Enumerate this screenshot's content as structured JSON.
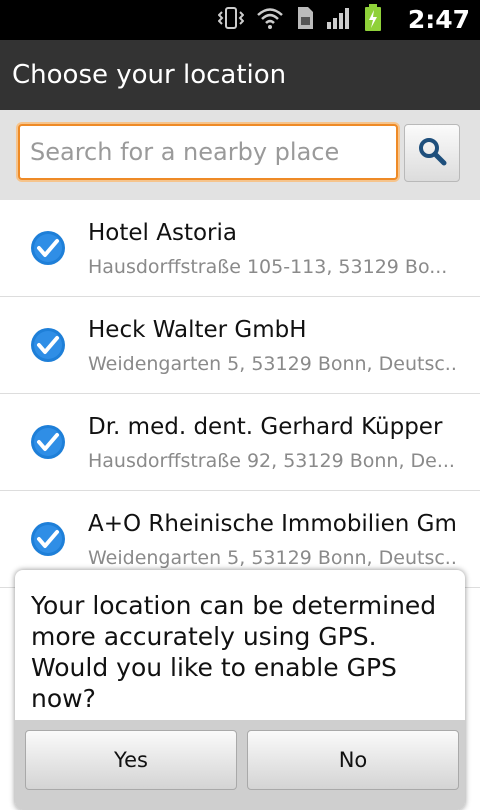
{
  "status_bar": {
    "time": "2:47",
    "icons": [
      "vibrate-icon",
      "wifi-icon",
      "sim-card-icon",
      "signal-icon",
      "battery-charging-icon"
    ]
  },
  "title_bar": {
    "title": "Choose your location"
  },
  "search": {
    "placeholder": "Search for a nearby place",
    "value": ""
  },
  "places": [
    {
      "name": "Hotel Astoria",
      "address": "Hausdorffstraße 105-113, 53129 Bo..."
    },
    {
      "name": "Heck Walter GmbH",
      "address": "Weidengarten 5, 53129 Bonn, Deutsc..."
    },
    {
      "name": "Dr. med. dent. Gerhard Küpper",
      "address": "Hausdorffstraße 92, 53129 Bonn, De..."
    },
    {
      "name": "A+O Rheinische Immobilien Gm...",
      "address": "Weidengarten 5, 53129 Bonn, Deutsc..."
    }
  ],
  "dialog": {
    "message": "Your location can be determined more accurately using GPS. Would you like to enable GPS now?",
    "yes_label": "Yes",
    "no_label": "No"
  },
  "colors": {
    "accent_orange": "#ee8a26",
    "check_blue": "#1e7fd8",
    "title_bar": "#333333"
  }
}
